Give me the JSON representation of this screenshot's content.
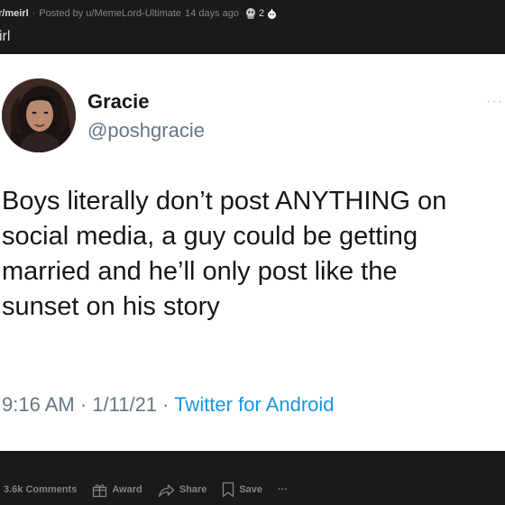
{
  "post": {
    "subreddit": "r/meirl",
    "separator": "·",
    "posted_by": "Posted by u/MemeLord-Ultimate",
    "age": "14 days ago",
    "award_count": "2",
    "title": "irl"
  },
  "tweet": {
    "name": "Gracie",
    "handle": "@poshgracie",
    "more": "···",
    "lines": [
      "Boys literally don’t post ANYTHING on",
      "social media, a guy could be getting",
      "married and he’ll only post like the",
      "sunset on his story"
    ],
    "time": "9:16 AM · 1/11/21 · ",
    "source": "Twitter for Android"
  },
  "actions": {
    "comments": "3.6k Comments",
    "award": "Award",
    "share": "Share",
    "save": "Save",
    "more": "···"
  },
  "icons": {
    "award": "award-gift-icon",
    "share": "share-arrow-icon",
    "save": "bookmark-icon",
    "avatar": "avatar-photo"
  }
}
